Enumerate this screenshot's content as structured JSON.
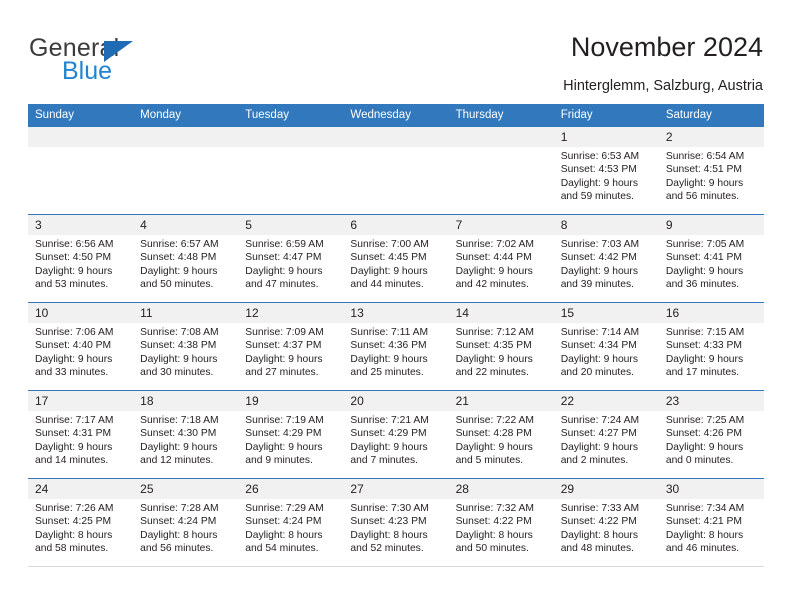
{
  "brand": {
    "name_part1": "General",
    "name_part2": "Blue",
    "accent_color": "#2284d0",
    "triangle_color": "#1f6cb5",
    "logo_icon": "triangle-icon"
  },
  "header": {
    "title": "November 2024",
    "subtitle": "Hinterglemm, Salzburg, Austria"
  },
  "calendar": {
    "header_bg": "#3178bd",
    "header_text_color": "#ffffff",
    "daynum_band_bg": "#f1f1f1",
    "weekdays": [
      "Sunday",
      "Monday",
      "Tuesday",
      "Wednesday",
      "Thursday",
      "Friday",
      "Saturday"
    ],
    "weeks": [
      [
        {
          "day": "",
          "empty": true
        },
        {
          "day": "",
          "empty": true
        },
        {
          "day": "",
          "empty": true
        },
        {
          "day": "",
          "empty": true
        },
        {
          "day": "",
          "empty": true
        },
        {
          "day": "1",
          "sunrise": "Sunrise: 6:53 AM",
          "sunset": "Sunset: 4:53 PM",
          "daylight": "Daylight: 9 hours and 59 minutes."
        },
        {
          "day": "2",
          "sunrise": "Sunrise: 6:54 AM",
          "sunset": "Sunset: 4:51 PM",
          "daylight": "Daylight: 9 hours and 56 minutes."
        }
      ],
      [
        {
          "day": "3",
          "sunrise": "Sunrise: 6:56 AM",
          "sunset": "Sunset: 4:50 PM",
          "daylight": "Daylight: 9 hours and 53 minutes."
        },
        {
          "day": "4",
          "sunrise": "Sunrise: 6:57 AM",
          "sunset": "Sunset: 4:48 PM",
          "daylight": "Daylight: 9 hours and 50 minutes."
        },
        {
          "day": "5",
          "sunrise": "Sunrise: 6:59 AM",
          "sunset": "Sunset: 4:47 PM",
          "daylight": "Daylight: 9 hours and 47 minutes."
        },
        {
          "day": "6",
          "sunrise": "Sunrise: 7:00 AM",
          "sunset": "Sunset: 4:45 PM",
          "daylight": "Daylight: 9 hours and 44 minutes."
        },
        {
          "day": "7",
          "sunrise": "Sunrise: 7:02 AM",
          "sunset": "Sunset: 4:44 PM",
          "daylight": "Daylight: 9 hours and 42 minutes."
        },
        {
          "day": "8",
          "sunrise": "Sunrise: 7:03 AM",
          "sunset": "Sunset: 4:42 PM",
          "daylight": "Daylight: 9 hours and 39 minutes."
        },
        {
          "day": "9",
          "sunrise": "Sunrise: 7:05 AM",
          "sunset": "Sunset: 4:41 PM",
          "daylight": "Daylight: 9 hours and 36 minutes."
        }
      ],
      [
        {
          "day": "10",
          "sunrise": "Sunrise: 7:06 AM",
          "sunset": "Sunset: 4:40 PM",
          "daylight": "Daylight: 9 hours and 33 minutes."
        },
        {
          "day": "11",
          "sunrise": "Sunrise: 7:08 AM",
          "sunset": "Sunset: 4:38 PM",
          "daylight": "Daylight: 9 hours and 30 minutes."
        },
        {
          "day": "12",
          "sunrise": "Sunrise: 7:09 AM",
          "sunset": "Sunset: 4:37 PM",
          "daylight": "Daylight: 9 hours and 27 minutes."
        },
        {
          "day": "13",
          "sunrise": "Sunrise: 7:11 AM",
          "sunset": "Sunset: 4:36 PM",
          "daylight": "Daylight: 9 hours and 25 minutes."
        },
        {
          "day": "14",
          "sunrise": "Sunrise: 7:12 AM",
          "sunset": "Sunset: 4:35 PM",
          "daylight": "Daylight: 9 hours and 22 minutes."
        },
        {
          "day": "15",
          "sunrise": "Sunrise: 7:14 AM",
          "sunset": "Sunset: 4:34 PM",
          "daylight": "Daylight: 9 hours and 20 minutes."
        },
        {
          "day": "16",
          "sunrise": "Sunrise: 7:15 AM",
          "sunset": "Sunset: 4:33 PM",
          "daylight": "Daylight: 9 hours and 17 minutes."
        }
      ],
      [
        {
          "day": "17",
          "sunrise": "Sunrise: 7:17 AM",
          "sunset": "Sunset: 4:31 PM",
          "daylight": "Daylight: 9 hours and 14 minutes."
        },
        {
          "day": "18",
          "sunrise": "Sunrise: 7:18 AM",
          "sunset": "Sunset: 4:30 PM",
          "daylight": "Daylight: 9 hours and 12 minutes."
        },
        {
          "day": "19",
          "sunrise": "Sunrise: 7:19 AM",
          "sunset": "Sunset: 4:29 PM",
          "daylight": "Daylight: 9 hours and 9 minutes."
        },
        {
          "day": "20",
          "sunrise": "Sunrise: 7:21 AM",
          "sunset": "Sunset: 4:29 PM",
          "daylight": "Daylight: 9 hours and 7 minutes."
        },
        {
          "day": "21",
          "sunrise": "Sunrise: 7:22 AM",
          "sunset": "Sunset: 4:28 PM",
          "daylight": "Daylight: 9 hours and 5 minutes."
        },
        {
          "day": "22",
          "sunrise": "Sunrise: 7:24 AM",
          "sunset": "Sunset: 4:27 PM",
          "daylight": "Daylight: 9 hours and 2 minutes."
        },
        {
          "day": "23",
          "sunrise": "Sunrise: 7:25 AM",
          "sunset": "Sunset: 4:26 PM",
          "daylight": "Daylight: 9 hours and 0 minutes."
        }
      ],
      [
        {
          "day": "24",
          "sunrise": "Sunrise: 7:26 AM",
          "sunset": "Sunset: 4:25 PM",
          "daylight": "Daylight: 8 hours and 58 minutes."
        },
        {
          "day": "25",
          "sunrise": "Sunrise: 7:28 AM",
          "sunset": "Sunset: 4:24 PM",
          "daylight": "Daylight: 8 hours and 56 minutes."
        },
        {
          "day": "26",
          "sunrise": "Sunrise: 7:29 AM",
          "sunset": "Sunset: 4:24 PM",
          "daylight": "Daylight: 8 hours and 54 minutes."
        },
        {
          "day": "27",
          "sunrise": "Sunrise: 7:30 AM",
          "sunset": "Sunset: 4:23 PM",
          "daylight": "Daylight: 8 hours and 52 minutes."
        },
        {
          "day": "28",
          "sunrise": "Sunrise: 7:32 AM",
          "sunset": "Sunset: 4:22 PM",
          "daylight": "Daylight: 8 hours and 50 minutes."
        },
        {
          "day": "29",
          "sunrise": "Sunrise: 7:33 AM",
          "sunset": "Sunset: 4:22 PM",
          "daylight": "Daylight: 8 hours and 48 minutes."
        },
        {
          "day": "30",
          "sunrise": "Sunrise: 7:34 AM",
          "sunset": "Sunset: 4:21 PM",
          "daylight": "Daylight: 8 hours and 46 minutes."
        }
      ]
    ]
  }
}
